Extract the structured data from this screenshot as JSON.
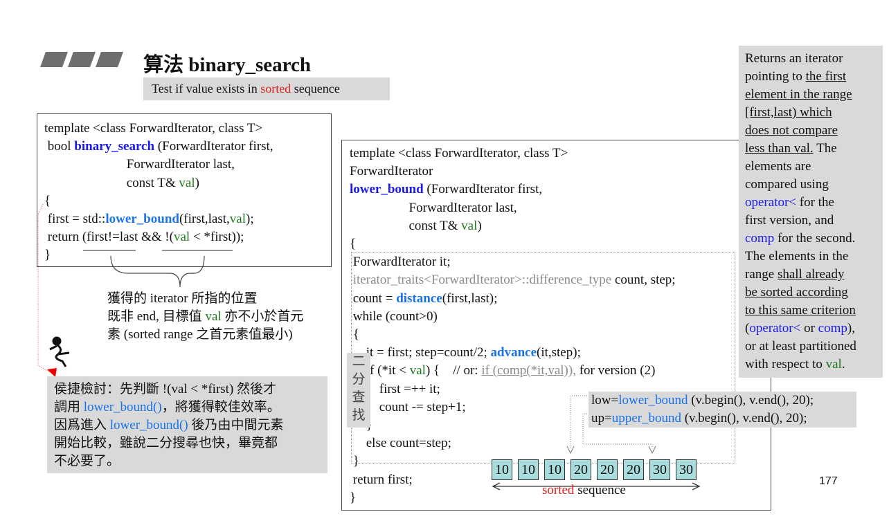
{
  "title": {
    "prefix": "算法 ",
    "name": "binary_search"
  },
  "subtitle": [
    {
      "t": "Test if value exists in "
    },
    {
      "t": "sorted",
      "c": "red"
    },
    {
      "t": " sequence"
    }
  ],
  "binary_search_code": [
    [
      {
        "t": "template <class ForwardIterator, class T>"
      }
    ],
    [
      {
        "t": " bool "
      },
      {
        "t": "binary_search",
        "c": "blue"
      },
      {
        "t": " (ForwardIterator first,"
      }
    ],
    [
      {
        "t": "                         ForwardIterator last,"
      }
    ],
    [
      {
        "t": "                         const T& "
      },
      {
        "t": "val",
        "c": "green"
      },
      {
        "t": ")"
      }
    ],
    [
      {
        "t": "{"
      }
    ],
    [
      {
        "t": " first = std::"
      },
      {
        "t": "lower_bound",
        "c": "bblue"
      },
      {
        "t": "(first,last,"
      },
      {
        "t": "val",
        "c": "green"
      },
      {
        "t": ");"
      }
    ],
    [
      {
        "t": " return (first!=last && !("
      },
      {
        "t": "val",
        "c": "green"
      },
      {
        "t": " < *first));"
      }
    ],
    [
      {
        "t": "}"
      }
    ]
  ],
  "caption": [
    [
      {
        "t": "獲得的 iterator 所指的位置"
      }
    ],
    [
      {
        "t": "既非 end, 目標值 "
      },
      {
        "t": "val",
        "c": "green"
      },
      {
        "t": " 亦不小於首元"
      }
    ],
    [
      {
        "t": "素 (sorted range 之首元素值最小)"
      }
    ]
  ],
  "note": [
    [
      {
        "t": "侯捷檢討：先判斷 !(val < *first) 然後才"
      }
    ],
    [
      {
        "t": "調用 "
      },
      {
        "t": "lower_bound()",
        "c": "lblue"
      },
      {
        "t": "，將獲得較佳效率。"
      }
    ],
    [
      {
        "t": "因爲進入 "
      },
      {
        "t": "lower_bound()",
        "c": "lblue"
      },
      {
        "t": " 後乃由中間元素"
      }
    ],
    [
      {
        "t": "開始比較，雖說二分搜尋也快，畢竟都"
      }
    ],
    [
      {
        "t": "不必要了。"
      }
    ]
  ],
  "lower_bound_code": [
    [
      {
        "t": "template <class ForwardIterator, class T>"
      }
    ],
    [
      {
        "t": "ForwardIterator"
      }
    ],
    [
      {
        "t": "lower_bound",
        "c": "blue"
      },
      {
        "t": " (ForwardIterator first,"
      }
    ],
    [
      {
        "t": "                  ForwardIterator last,"
      }
    ],
    [
      {
        "t": "                  const T& "
      },
      {
        "t": "val",
        "c": "green"
      },
      {
        "t": ")"
      }
    ],
    [
      {
        "t": "{"
      }
    ],
    [
      {
        "t": " ForwardIterator it;"
      }
    ],
    [
      {
        "t": " iterator_traits<ForwardIterator>::difference_type",
        "c": "gray"
      },
      {
        "t": " count, step;"
      }
    ],
    [
      {
        "t": " count = "
      },
      {
        "t": "distance",
        "c": "bblue"
      },
      {
        "t": "(first,last);"
      }
    ],
    [
      {
        "t": " while (count>0)"
      }
    ],
    [
      {
        "t": " {"
      }
    ],
    [
      {
        "t": "     it = first; step=count/2; "
      },
      {
        "t": "advance",
        "c": "bblue"
      },
      {
        "t": "(it,step);"
      }
    ],
    [
      {
        "t": "     if (*it < "
      },
      {
        "t": "val",
        "c": "green"
      },
      {
        "t": ") {    // or: "
      },
      {
        "t": "if (comp(*it,val)),",
        "c": "ugray"
      },
      {
        "t": " for version (2)"
      }
    ],
    [
      {
        "t": "         first =++ it;"
      }
    ],
    [
      {
        "t": "         count -= step+1;"
      }
    ],
    [
      {
        "t": "     }"
      }
    ],
    [
      {
        "t": "     else count=step;"
      }
    ],
    [
      {
        "t": " }"
      }
    ],
    [
      {
        "t": " return first;"
      }
    ],
    [
      {
        "t": "}"
      }
    ]
  ],
  "side_label": "二\n分\n查\n找",
  "usage": [
    [
      {
        "t": "low="
      },
      {
        "t": "lower_bound",
        "c": "lblue"
      },
      {
        "t": " (v.begin(), v.end(), 20);"
      }
    ],
    [
      {
        "t": "up="
      },
      {
        "t": "upper_bound",
        "c": "lblue"
      },
      {
        "t": " (v.begin(), v.end(), 20);"
      }
    ]
  ],
  "sequence_values": [
    "10",
    "10",
    "10",
    "20",
    "20",
    "20",
    "30",
    "30"
  ],
  "sequence_label": [
    {
      "t": "sorted",
      "c": "red"
    },
    {
      "t": " sequence"
    }
  ],
  "description": [
    [
      {
        "t": "Returns an iterator"
      }
    ],
    [
      {
        "t": "pointing to "
      },
      {
        "t": "the first",
        "c": "ul"
      }
    ],
    [
      {
        "t": "element in the range",
        "c": "ul"
      }
    ],
    [
      {
        "t": "[first,last) which",
        "c": "ul"
      }
    ],
    [
      {
        "t": "does not compare",
        "c": "ul"
      }
    ],
    [
      {
        "t": "less than val.",
        "c": "ul"
      },
      {
        "t": " The"
      }
    ],
    [
      {
        "t": "elements are"
      }
    ],
    [
      {
        "t": "compared using"
      }
    ],
    [
      {
        "t": "operator<",
        "c": "pblue"
      },
      {
        "t": " for the"
      }
    ],
    [
      {
        "t": "first version, and"
      }
    ],
    [
      {
        "t": "comp",
        "c": "pblue"
      },
      {
        "t": " for the second."
      }
    ],
    [
      {
        "t": "The elements in the"
      }
    ],
    [
      {
        "t": "range "
      },
      {
        "t": "shall already",
        "c": "ul"
      }
    ],
    [
      {
        "t": "be sorted according",
        "c": "ul"
      }
    ],
    [
      {
        "t": "to this same criterion",
        "c": "ul"
      }
    ],
    [
      {
        "t": "("
      },
      {
        "t": "operator<",
        "c": "pblue"
      },
      {
        "t": " or "
      },
      {
        "t": "comp",
        "c": "pblue"
      },
      {
        "t": "),"
      }
    ],
    [
      {
        "t": "or at least partitioned"
      }
    ],
    [
      {
        "t": "with respect to "
      },
      {
        "t": "val",
        "c": "green"
      },
      {
        "t": "."
      }
    ]
  ],
  "page_number": "177"
}
